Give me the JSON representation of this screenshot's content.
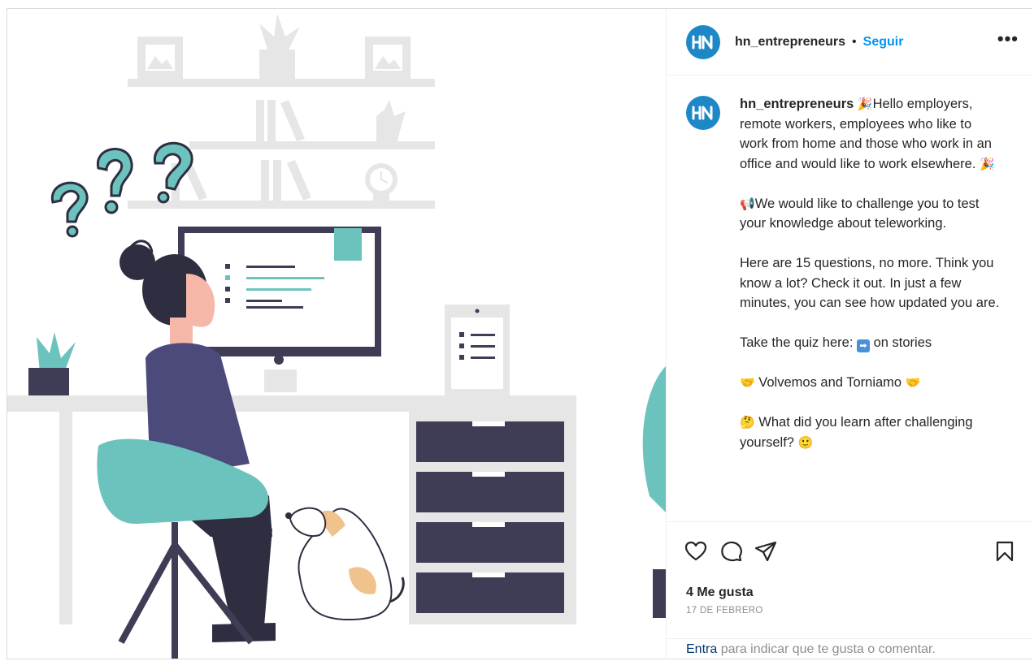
{
  "colors": {
    "accent_blue": "#0095f6",
    "avatar_blue": "#1e88c7",
    "teal": "#6cc3bd",
    "dark_purple": "#3f3d56",
    "shirt_purple": "#4c4a7a",
    "skin": "#f5b8a8",
    "shelf_gray": "#e6e6e6"
  },
  "post": {
    "avatar_text": "H-N",
    "username": "hn_entrepreneurs",
    "separator": "•",
    "follow_label": "Seguir",
    "more_icon": "•••"
  },
  "caption": {
    "username": "hn_entrepreneurs",
    "emoji_party": "🎉",
    "line1": "Hello employers, remote workers, employees who like to work from home and those who work in an office and would like to work elsewhere.",
    "emoji_megaphone": "📢",
    "line2": "We would like to challenge you to test your knowledge about teleworking.",
    "line3": "Here are 15 questions, no more. Think you know a lot? Check it out. In just a few minutes, you can see how updated you are.",
    "line4_prefix": "Take the quiz here:",
    "emoji_arrow": "➡",
    "line4_suffix": "on stories",
    "emoji_handshake": "🤝",
    "line5": "Volvemos and Torniamo",
    "emoji_thinking": "🤔",
    "line6": "What did you learn after challenging yourself?",
    "emoji_smile": "🙂"
  },
  "actions": {
    "like_icon": "heart-icon",
    "comment_icon": "comment-icon",
    "share_icon": "paper-plane-icon",
    "save_icon": "bookmark-icon"
  },
  "likes_text": "4 Me gusta",
  "date_text": "17 DE FEBRERO",
  "login_prompt": {
    "link": "Entra",
    "rest": "para indicar que te gusta o comentar."
  }
}
